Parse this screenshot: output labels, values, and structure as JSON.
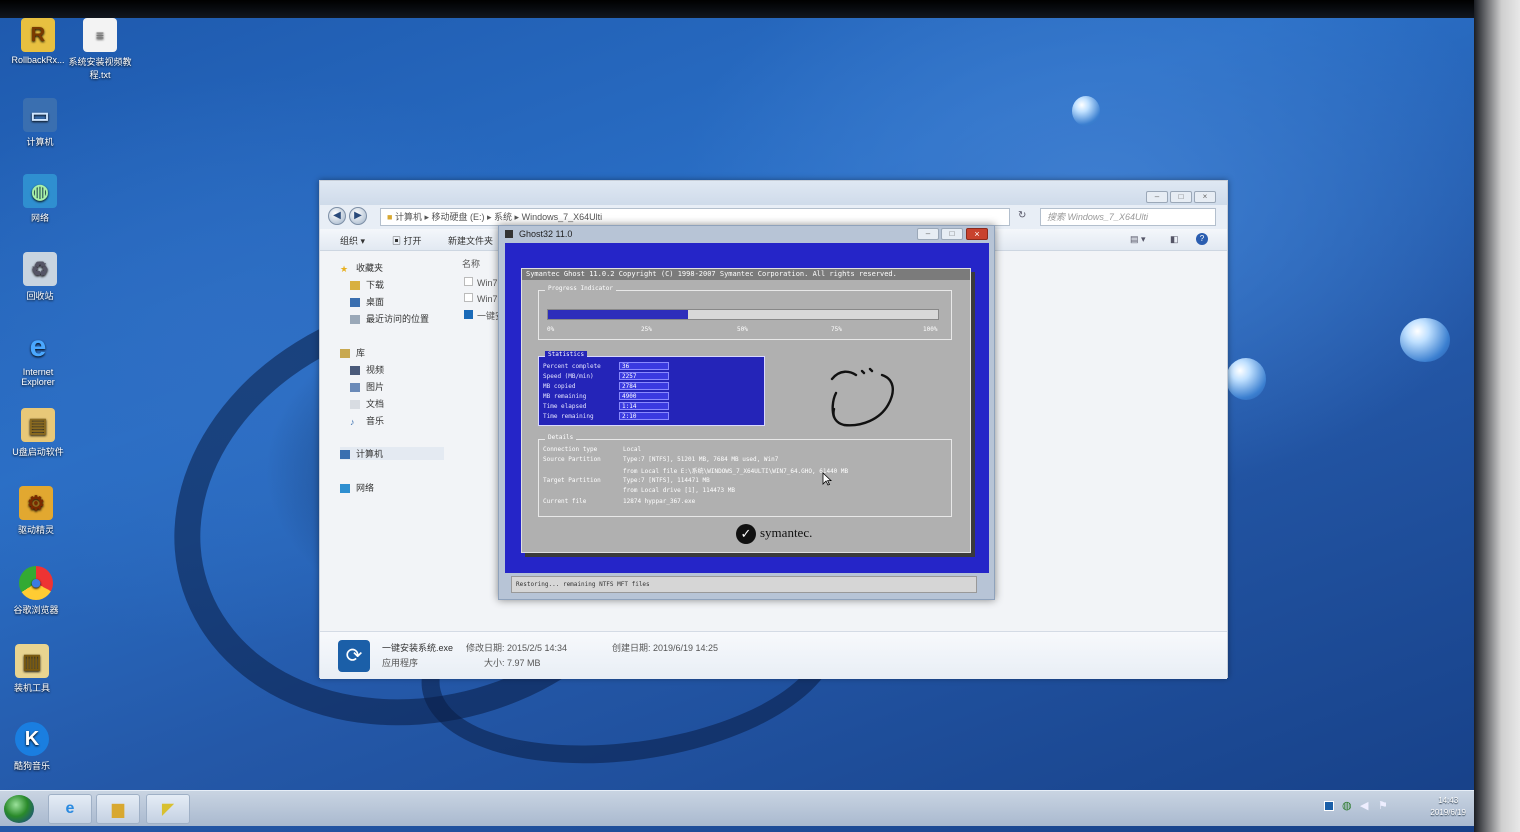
{
  "desktop": {
    "icons": [
      {
        "label": "RollbackRx...",
        "icon": "rollback-icon"
      },
      {
        "label": "系统安装视频教程.txt",
        "icon": "text-file-icon"
      },
      {
        "label": "计算机",
        "icon": "computer-icon"
      },
      {
        "label": "网络",
        "icon": "network-icon"
      },
      {
        "label": "回收站",
        "icon": "recycle-bin-icon"
      },
      {
        "label": "Internet Explorer",
        "icon": "internet-explorer-icon"
      },
      {
        "label": "U盘启动软件",
        "icon": "folder-icon"
      },
      {
        "label": "驱动精灵",
        "icon": "driver-icon"
      },
      {
        "label": "谷歌浏览器",
        "icon": "chrome-icon"
      },
      {
        "label": "装机工具",
        "icon": "tools-folder-icon"
      },
      {
        "label": "酷狗音乐",
        "icon": "kugou-icon"
      }
    ]
  },
  "explorer": {
    "breadcrumb": [
      "计算机",
      "移动硬盘 (E:)",
      "系统",
      "Windows_7_X64Ulti"
    ],
    "search_placeholder": "搜索 Windows_7_X64Ulti",
    "toolbar": {
      "organize": "组织 ▾",
      "open": "打开",
      "new_folder": "新建文件夹"
    },
    "nav": {
      "favorites": "收藏夹",
      "downloads": "下载",
      "desktop": "桌面",
      "recent": "最近访问的位置",
      "libraries": "库",
      "videos": "视频",
      "pictures": "图片",
      "documents": "文档",
      "music": "音乐",
      "computer": "计算机",
      "network": "网络"
    },
    "column_name": "名称",
    "files": [
      "Win7",
      "Win7",
      "一键安"
    ],
    "details": {
      "filename": "一键安装系统.exe",
      "modified_label": "修改日期: 2015/2/5 14:34",
      "created_label": "创建日期: 2019/6/19 14:25",
      "type": "应用程序",
      "size_label": "大小: 7.97 MB"
    }
  },
  "ghost": {
    "title": "Ghost32 11.0",
    "header": "Symantec Ghost 11.0.2   Copyright (C) 1998-2007 Symantec Corporation. All rights reserved.",
    "progress_label": "Progress Indicator",
    "progress_fraction": 0.36,
    "ticks": [
      "0%",
      "25%",
      "50%",
      "75%",
      "100%"
    ],
    "statistics_label": "Statistics",
    "stats": [
      {
        "key": "Percent complete",
        "value": "36"
      },
      {
        "key": "Speed (MB/min)",
        "value": "2257"
      },
      {
        "key": "MB copied",
        "value": "2784"
      },
      {
        "key": "MB remaining",
        "value": "4900"
      },
      {
        "key": "Time elapsed",
        "value": "1:14"
      },
      {
        "key": "Time remaining",
        "value": "2:10"
      }
    ],
    "details_label": "Details",
    "details": [
      {
        "key": "Connection type",
        "value": "Local"
      },
      {
        "key": "Source Partition",
        "value": "Type:7 [NTFS], 51201 MB, 7684 MB used, Win7"
      },
      {
        "key": "",
        "value": "from Local file E:\\系统\\WINDOWS_7_X64ULTI\\WIN7_64.GHO, 61440 MB"
      },
      {
        "key": "Target Partition",
        "value": "Type:7 [NTFS], 114471 MB"
      },
      {
        "key": "",
        "value": "from Local drive [1], 114473 MB"
      },
      {
        "key": "Current file",
        "value": "12874 hyppar_367.exe"
      }
    ],
    "brand": "symantec.",
    "status": "Restoring... remaining NTFS MFT files"
  },
  "taskbar": {
    "time": "14:43",
    "date": "2019/6/19"
  }
}
